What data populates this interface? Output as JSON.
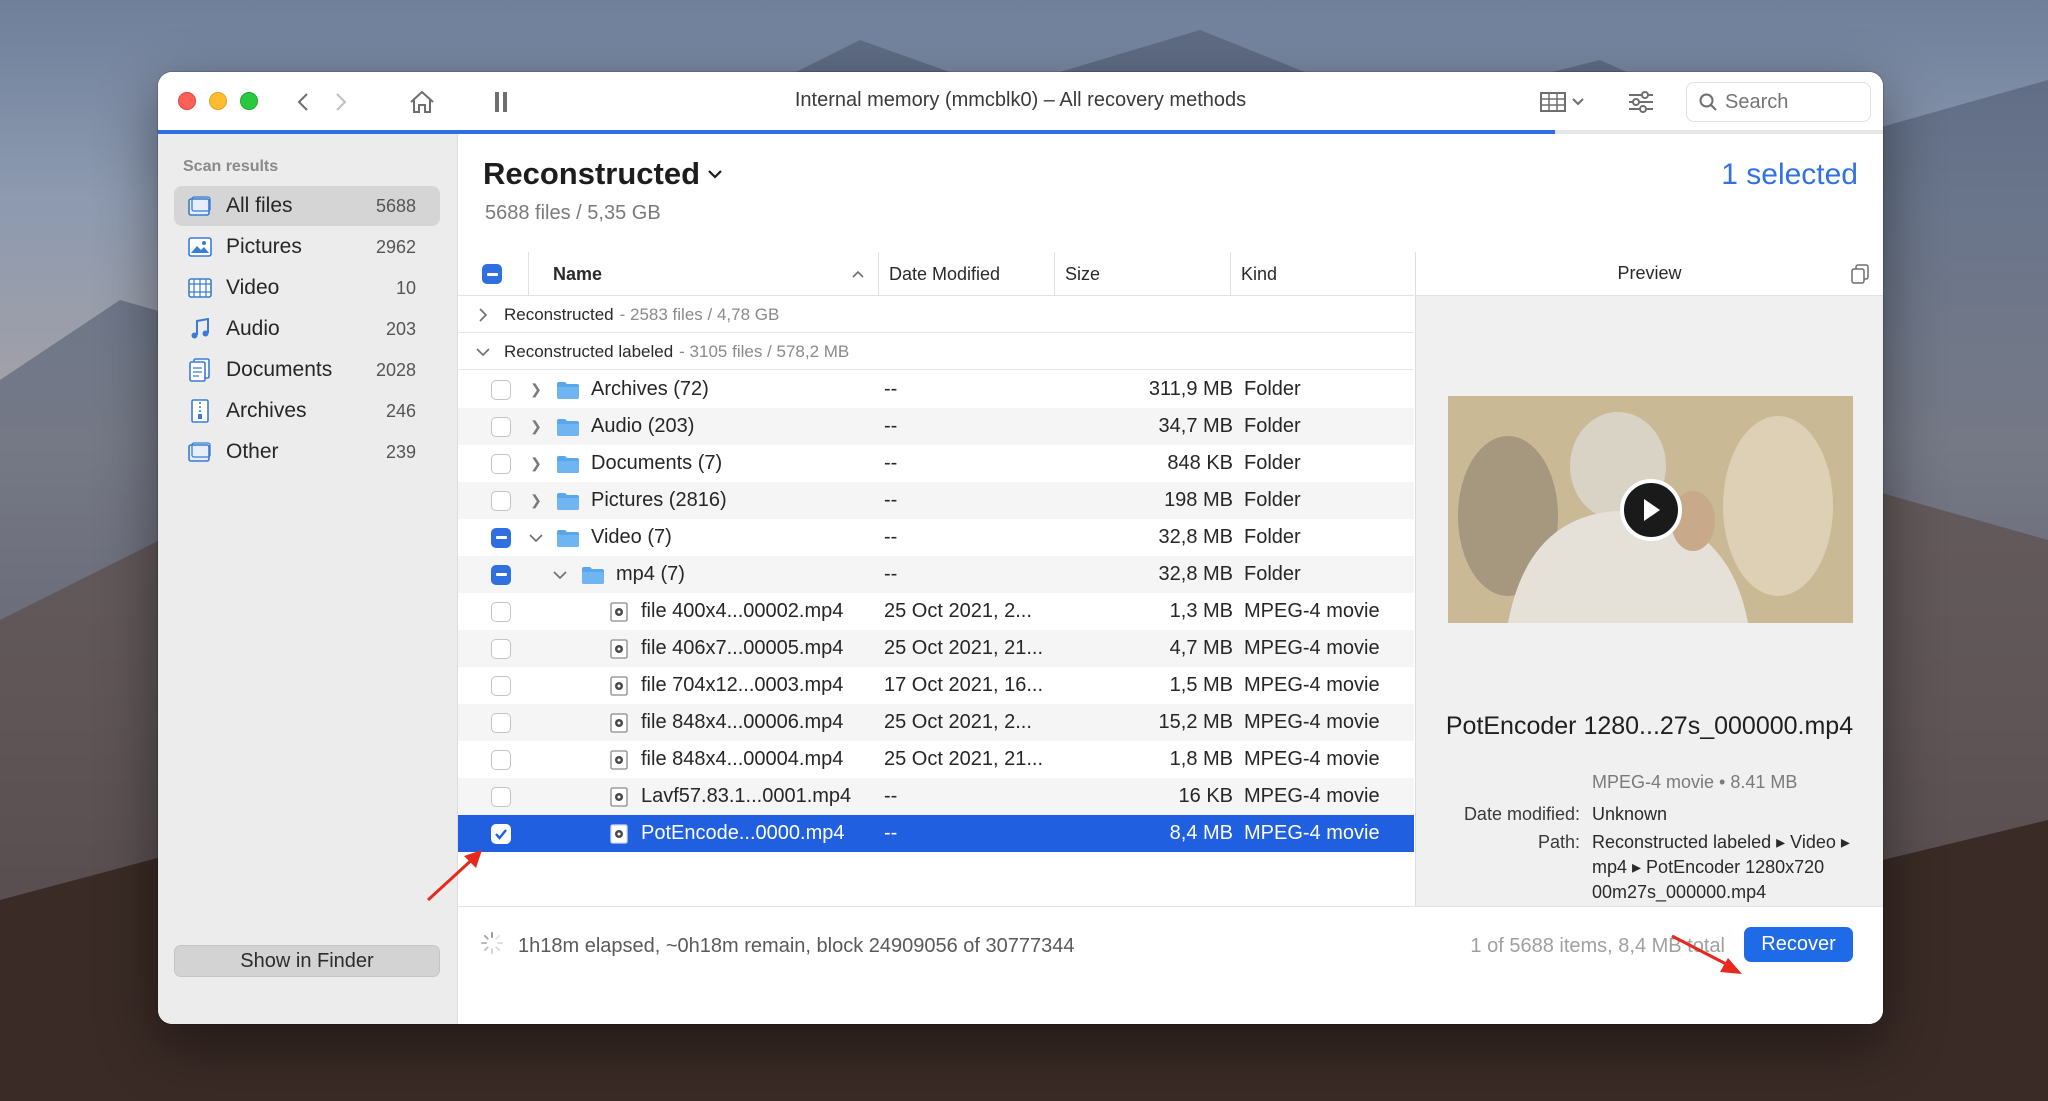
{
  "window": {
    "title": "Internal memory (mmcblk0) – All recovery methods",
    "search_placeholder": "Search",
    "scan_progress": 0.81
  },
  "sidebar": {
    "heading": "Scan results",
    "items": [
      {
        "label": "All files",
        "count": "5688",
        "icon": "all-files-icon"
      },
      {
        "label": "Pictures",
        "count": "2962",
        "icon": "pictures-icon"
      },
      {
        "label": "Video",
        "count": "10",
        "icon": "video-icon"
      },
      {
        "label": "Audio",
        "count": "203",
        "icon": "audio-icon"
      },
      {
        "label": "Documents",
        "count": "2028",
        "icon": "documents-icon"
      },
      {
        "label": "Archives",
        "count": "246",
        "icon": "archives-icon"
      },
      {
        "label": "Other",
        "count": "239",
        "icon": "other-icon"
      }
    ],
    "show_in_finder": "Show in Finder"
  },
  "main": {
    "title": "Reconstructed",
    "subtitle": "5688 files / 5,35 GB",
    "selected": "1 selected"
  },
  "table": {
    "columns": {
      "name": "Name",
      "date": "Date Modified",
      "size": "Size",
      "kind": "Kind"
    },
    "groups": [
      {
        "label": "Reconstructed",
        "detail": "- 2583 files / 4,78 GB"
      },
      {
        "label": "Reconstructed labeled",
        "detail": "- 3105 files / 578,2 MB"
      }
    ],
    "rows": [
      {
        "name": "Archives (72)",
        "date": "--",
        "size": "311,9 MB",
        "kind": "Folder"
      },
      {
        "name": "Audio (203)",
        "date": "--",
        "size": "34,7 MB",
        "kind": "Folder"
      },
      {
        "name": "Documents (7)",
        "date": "--",
        "size": "848 KB",
        "kind": "Folder"
      },
      {
        "name": "Pictures (2816)",
        "date": "--",
        "size": "198 MB",
        "kind": "Folder"
      },
      {
        "name": "Video (7)",
        "date": "--",
        "size": "32,8 MB",
        "kind": "Folder"
      },
      {
        "name": "mp4 (7)",
        "date": "--",
        "size": "32,8 MB",
        "kind": "Folder"
      },
      {
        "name": "file 400x4...00002.mp4",
        "date": "25 Oct 2021, 2...",
        "size": "1,3 MB",
        "kind": "MPEG-4 movie"
      },
      {
        "name": "file 406x7...00005.mp4",
        "date": "25 Oct 2021, 21...",
        "size": "4,7 MB",
        "kind": "MPEG-4 movie"
      },
      {
        "name": "file 704x12...0003.mp4",
        "date": "17 Oct 2021, 16...",
        "size": "1,5 MB",
        "kind": "MPEG-4 movie"
      },
      {
        "name": "file 848x4...00006.mp4",
        "date": "25 Oct 2021, 2...",
        "size": "15,2 MB",
        "kind": "MPEG-4 movie"
      },
      {
        "name": "file 848x4...00004.mp4",
        "date": "25 Oct 2021, 21...",
        "size": "1,8 MB",
        "kind": "MPEG-4 movie"
      },
      {
        "name": "Lavf57.83.1...0001.mp4",
        "date": "--",
        "size": "16 KB",
        "kind": "MPEG-4 movie"
      },
      {
        "name": "PotEncode...0000.mp4",
        "date": "--",
        "size": "8,4 MB",
        "kind": "MPEG-4 movie"
      }
    ]
  },
  "preview": {
    "heading": "Preview",
    "file_name": "PotEncoder 1280...27s_000000.mp4",
    "kind_size": "MPEG-4 movie • 8.41 MB",
    "date_label": "Date modified:",
    "date_value": "Unknown",
    "path_label": "Path:",
    "path_value": "Reconstructed labeled ▸ Video ▸ mp4 ▸ PotEncoder 1280x720 00m27s_000000.mp4"
  },
  "footer": {
    "status": "1h18m elapsed, ~0h18m remain, block 24909056 of 30777344",
    "summary": "1 of 5688 items, 8,4 MB total",
    "recover": "Recover"
  },
  "colors": {
    "accent": "#1f5fe0",
    "selected_text": "#2f72e0"
  }
}
